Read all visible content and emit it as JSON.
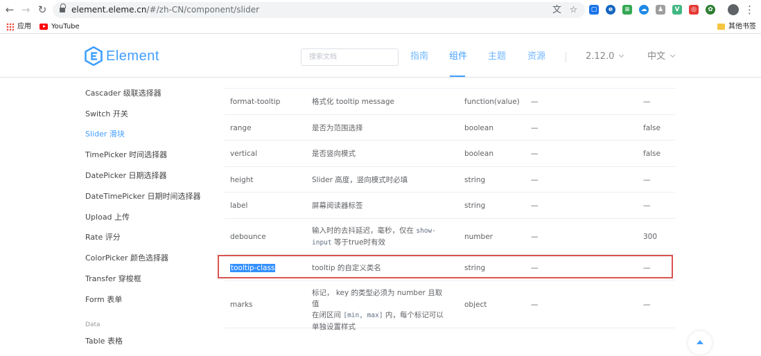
{
  "browser": {
    "url_domain": "element.eleme.cn",
    "url_path": "/#/zh-CN/component/slider",
    "bookmarks": {
      "apps": "应用",
      "youtube": "YouTube",
      "other": "其他书签"
    }
  },
  "header": {
    "logo": "Element",
    "search_placeholder": "搜索文档",
    "nav": [
      "指南",
      "组件",
      "主题",
      "资源"
    ],
    "version": "2.12.0",
    "language": "中文"
  },
  "sidebar": {
    "items": [
      "Cascader 级联选择器",
      "Switch 开关",
      "Slider 滑块",
      "TimePicker 时间选择器",
      "DatePicker 日期选择器",
      "DateTimePicker 日期时间选择器",
      "Upload 上传",
      "Rate 评分",
      "ColorPicker 颜色选择器",
      "Transfer 穿梭框",
      "Form 表单"
    ],
    "group_data": "Data",
    "table_item": "Table 表格"
  },
  "table": {
    "rows": [
      {
        "param": "format-tooltip",
        "desc": "格式化 tooltip message",
        "type": "function(value)",
        "options": "—",
        "default": "—"
      },
      {
        "param": "range",
        "desc": "是否为范围选择",
        "type": "boolean",
        "options": "—",
        "default": "false"
      },
      {
        "param": "vertical",
        "desc": "是否竖向模式",
        "type": "boolean",
        "options": "—",
        "default": "false"
      },
      {
        "param": "height",
        "desc": "Slider 高度，竖向模式时必填",
        "type": "string",
        "options": "—",
        "default": "—"
      },
      {
        "param": "label",
        "desc": "屏幕阅读器标签",
        "type": "string",
        "options": "—",
        "default": "—"
      },
      {
        "param": "debounce",
        "desc_a": "输入时的去抖延迟，毫秒，仅在 ",
        "desc_code1": "show-",
        "desc_code2": "input",
        "desc_b": " 等于true时有效",
        "type": "number",
        "options": "—",
        "default": "300"
      },
      {
        "param": "tooltip-class",
        "desc": "tooltip 的自定义类名",
        "type": "string",
        "options": "—",
        "default": "—"
      },
      {
        "param": "marks",
        "desc_a": "标记， key 的类型必须为 number 且取值",
        "desc_b1": "在闭区间 ",
        "desc_code": "[min, max]",
        "desc_b2": " 内，每个标记可以",
        "desc_c": "单独设置样式",
        "type": "object",
        "options": "—",
        "default": "—"
      }
    ]
  },
  "colors": {
    "accent": "#409eff",
    "highlight": "#d9534f",
    "selection": "#3390ff"
  }
}
